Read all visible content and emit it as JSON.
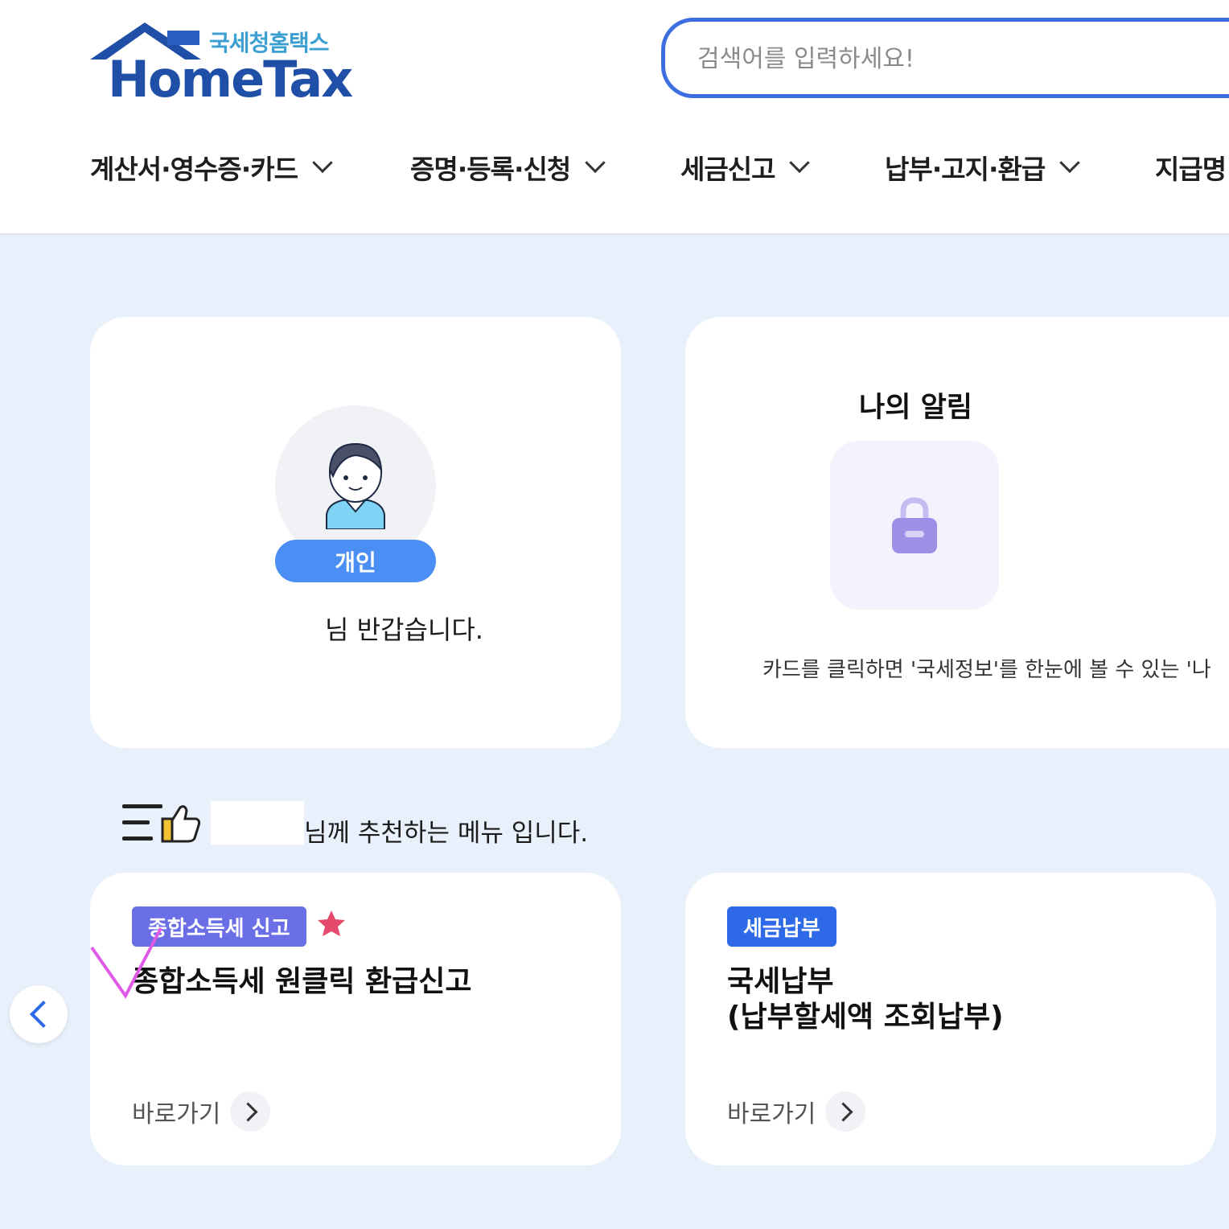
{
  "logo": {
    "subtitle": "국세청홈택스",
    "title": "HomeTax"
  },
  "search": {
    "placeholder": "검색어를 입력하세요!"
  },
  "nav": {
    "items": [
      {
        "label": "계산서·영수증·카드"
      },
      {
        "label": "증명·등록·신청"
      },
      {
        "label": "세금신고"
      },
      {
        "label": "납부·고지·환급"
      },
      {
        "label": "지급명"
      }
    ]
  },
  "profile": {
    "role": "개인",
    "greeting": "님 반갑습니다."
  },
  "alarm": {
    "title": "나의 알림",
    "description": "카드를 클릭하면 '국세정보'를 한눈에 볼 수 있는 '나",
    "icon": "lock-icon"
  },
  "recommend": {
    "text": "님께 추천하는 메뉴 입니다.",
    "icon": "thumbs-up-menu-icon"
  },
  "menu_cards": [
    {
      "tag": "종합소득세 신고",
      "title": "종합소득세 원클릭 환급신고",
      "link": "바로가기",
      "starred": true
    },
    {
      "tag": "세금납부",
      "title_line1": "국세납부",
      "title_line2": "(납부할세액 조회납부)",
      "link": "바로가기"
    }
  ],
  "colors": {
    "accent": "#2e6ae8",
    "pill": "#4b8ff5",
    "tag_purple": "#6b6fe6",
    "star": "#e64a6b",
    "bg": "#e8f1fb"
  }
}
